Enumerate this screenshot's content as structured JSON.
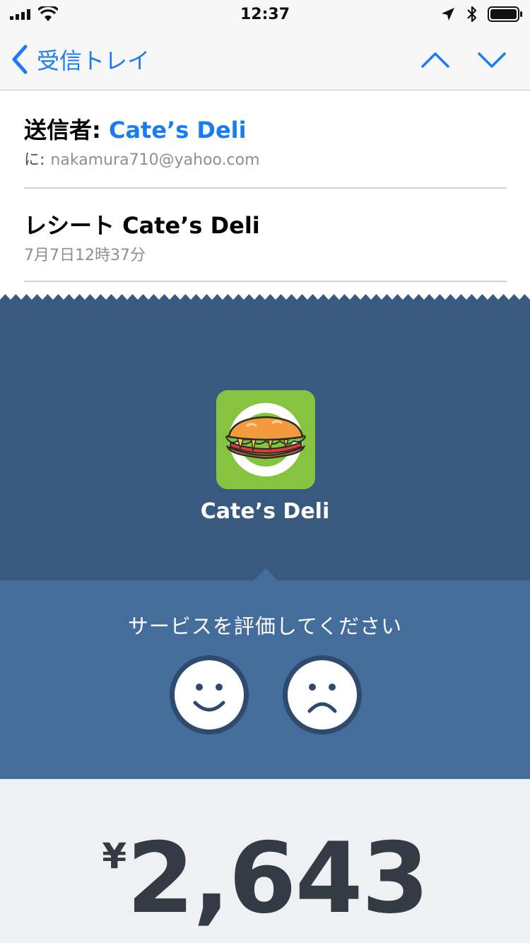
{
  "status_bar": {
    "time": "12:37"
  },
  "nav": {
    "back_label": "受信トレイ"
  },
  "header": {
    "from_label": "送信者:",
    "from_name": "Cate’s Deli",
    "to_label": "に:",
    "to_address": "nakamura710@yahoo.com",
    "subject": "レシート Cate’s Deli",
    "date": "7月7日12時37分"
  },
  "receipt": {
    "merchant_name": "Cate’s Deli",
    "rating_prompt": "サービスを評価してください",
    "currency_symbol": "¥",
    "amount": "2,643"
  },
  "colors": {
    "accent": "#1a7cf5",
    "merchant_band": "#385a80",
    "rating_band": "#456d9b",
    "logo_bg": "#86c440",
    "amount_text": "#343b44"
  }
}
